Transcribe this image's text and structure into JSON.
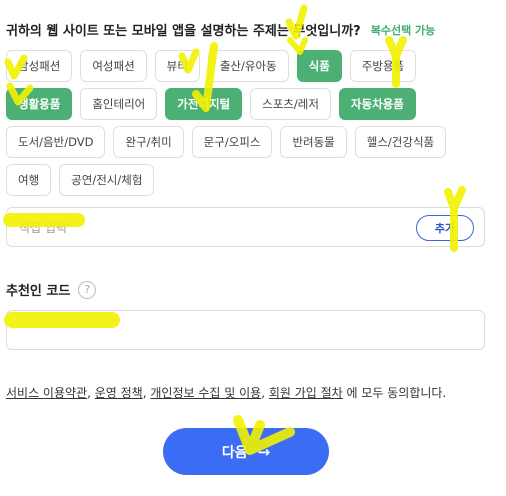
{
  "question": {
    "text": "귀하의 웹 사이트 또는 모바일 앱을 설명하는 주제는 무엇입니까?",
    "multi_select_note": "복수선택 가능"
  },
  "categories": [
    [
      {
        "label": "남성패션",
        "selected": false
      },
      {
        "label": "여성패션",
        "selected": false
      },
      {
        "label": "뷰티",
        "selected": false
      },
      {
        "label": "출산/유아동",
        "selected": false
      },
      {
        "label": "식품",
        "selected": true
      },
      {
        "label": "주방용품",
        "selected": false
      }
    ],
    [
      {
        "label": "생활용품",
        "selected": true
      },
      {
        "label": "홈인테리어",
        "selected": false
      },
      {
        "label": "가전디지털",
        "selected": true
      },
      {
        "label": "스포츠/레저",
        "selected": false
      },
      {
        "label": "자동차용품",
        "selected": true
      }
    ],
    [
      {
        "label": "도서/음반/DVD",
        "selected": false
      },
      {
        "label": "완구/취미",
        "selected": false
      },
      {
        "label": "문구/오피스",
        "selected": false
      },
      {
        "label": "반려동물",
        "selected": false
      },
      {
        "label": "헬스/건강식품",
        "selected": false
      }
    ],
    [
      {
        "label": "여행",
        "selected": false
      },
      {
        "label": "공연/전시/체험",
        "selected": false
      }
    ]
  ],
  "direct_input": {
    "placeholder": "직접 입력",
    "value": "",
    "add_label": "추가"
  },
  "referral": {
    "label": "추천인 코드",
    "help_icon": "question-circle-icon",
    "value": ""
  },
  "terms": {
    "links": [
      "서비스 이용약관",
      "운영 정책",
      "개인정보 수집 및 이용",
      "회원 가입 절차"
    ],
    "suffix": " 에 모두 동의합니다."
  },
  "next_button": {
    "label": "다음",
    "icon": "arrow-right-icon"
  },
  "colors": {
    "selected_chip": "#4caf73",
    "primary_button": "#3a6cf4",
    "highlighter": "#f2f200",
    "multi_select_note": "#3fae6e"
  }
}
